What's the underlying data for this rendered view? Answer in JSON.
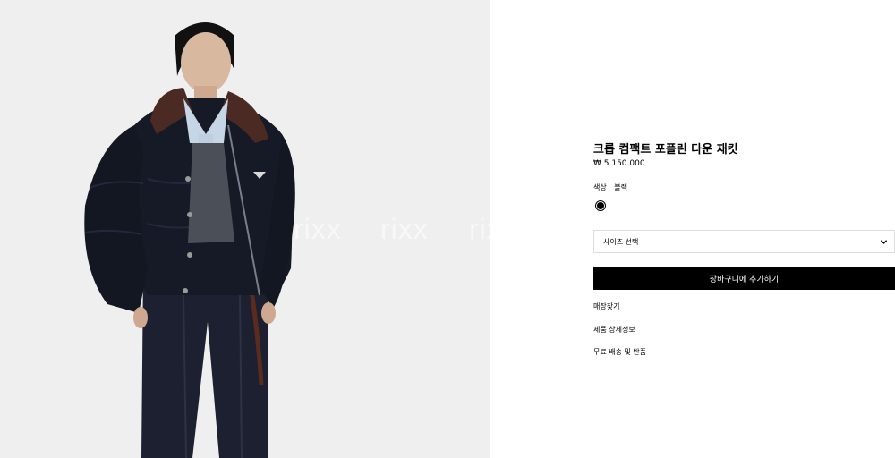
{
  "product": {
    "title": "크롭 컴팩트 포플린 다운 재킷",
    "price": "₩ 5.150.000",
    "color_label": "색상",
    "color_value": "블랙",
    "swatch_color": "#000000"
  },
  "size_select": {
    "label": "사이즈 선택"
  },
  "add_to_cart": {
    "label": "장바구니에 추가하기"
  },
  "links": {
    "find_store": "매장찾기",
    "product_details": "제품 상세정보",
    "free_shipping": "무료 배송 및 반품"
  },
  "watermark": {
    "text_1": "rixx",
    "text_2": "rixx",
    "text_3": "rix"
  },
  "colors": {
    "image_background": "#efefef",
    "button_bg": "#000000",
    "button_text": "#ffffff"
  }
}
